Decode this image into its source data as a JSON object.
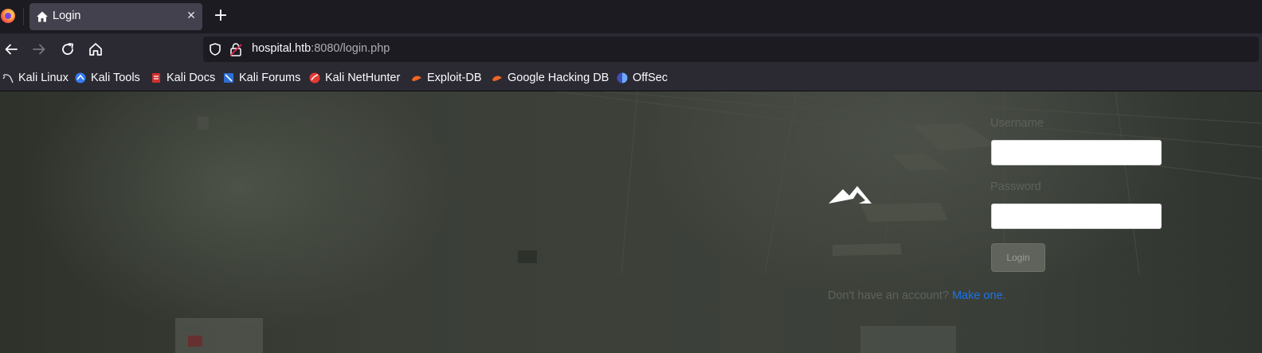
{
  "browser": {
    "tab": {
      "title": "Login",
      "close_glyph": "✕",
      "icon": "home-icon"
    },
    "new_tab_glyph": "+",
    "nav": {
      "back_icon": "back-arrow-icon",
      "forward_icon": "forward-arrow-icon",
      "reload_icon": "reload-icon",
      "home_icon": "home-icon"
    },
    "url": {
      "host": "hospital.htb",
      "rest": ":8080/login.php"
    },
    "bookmarks": [
      {
        "label": "Kali Linux",
        "icon": "kali-dragon-icon"
      },
      {
        "label": "Kali Tools",
        "icon": "kali-tools-icon"
      },
      {
        "label": "Kali Docs",
        "icon": "kali-docs-icon"
      },
      {
        "label": "Kali Forums",
        "icon": "kali-forums-icon"
      },
      {
        "label": "Kali NetHunter",
        "icon": "kali-nethunter-icon"
      },
      {
        "label": "Exploit-DB",
        "icon": "exploit-db-icon"
      },
      {
        "label": "Google Hacking DB",
        "icon": "ghdb-icon"
      },
      {
        "label": "OffSec",
        "icon": "offsec-icon"
      }
    ]
  },
  "login": {
    "username_label": "Username",
    "username_value": "",
    "password_label": "Password",
    "password_value": "",
    "login_button": "Login",
    "signup_prompt": "Don't have an account?",
    "signup_link": "Make one",
    "signup_suffix": "."
  },
  "colors": {
    "link": "#1a73e8",
    "chrome_dark": "#1c1b22",
    "chrome": "#2b2a33"
  }
}
